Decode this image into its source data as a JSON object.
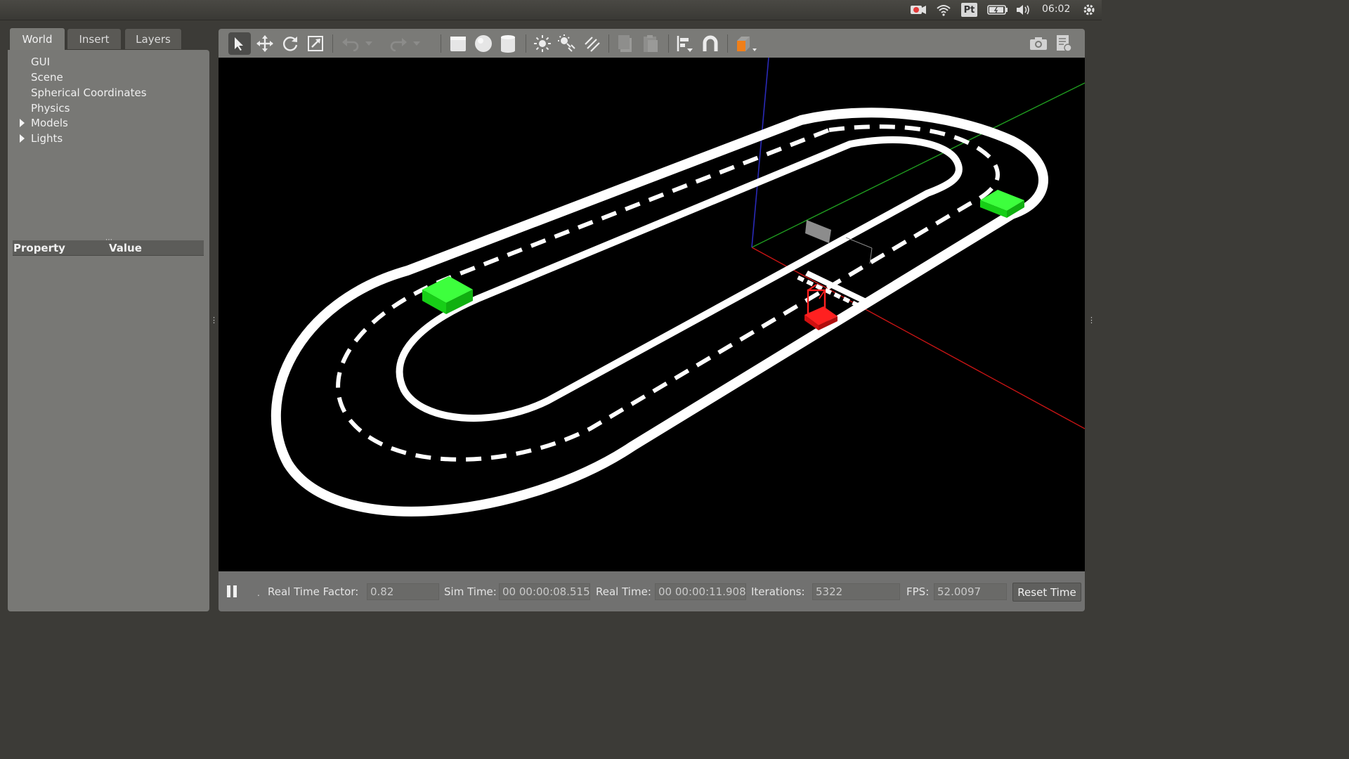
{
  "topbar": {
    "clock": "06:02",
    "icons": [
      "record-icon",
      "wifi-icon",
      "pt-input-icon",
      "battery-icon",
      "volume-icon",
      "settings-gear-icon"
    ],
    "pt_label": "Pt"
  },
  "left_panel": {
    "tabs": [
      {
        "label": "World",
        "active": true
      },
      {
        "label": "Insert",
        "active": false
      },
      {
        "label": "Layers",
        "active": false
      }
    ],
    "tree": [
      {
        "label": "GUI",
        "expandable": false
      },
      {
        "label": "Scene",
        "expandable": false
      },
      {
        "label": "Spherical Coordinates",
        "expandable": false
      },
      {
        "label": "Physics",
        "expandable": false
      },
      {
        "label": "Models",
        "expandable": true
      },
      {
        "label": "Lights",
        "expandable": true
      }
    ],
    "properties": {
      "col_property": "Property",
      "col_value": "Value"
    }
  },
  "toolbar": {
    "tools": [
      "select-arrow-icon",
      "translate-icon",
      "rotate-icon",
      "scale-icon",
      "undo-icon",
      "redo-icon",
      "box-shape-icon",
      "sphere-shape-icon",
      "cylinder-shape-icon",
      "point-light-icon",
      "spot-light-icon",
      "directional-light-icon",
      "copy-icon",
      "paste-icon",
      "align-icon",
      "snap-magnet-icon",
      "view-angle-icon",
      "screenshot-camera-icon",
      "log-icon"
    ],
    "active_tool": "select-arrow-icon"
  },
  "viewport": {
    "scene": "oval race track with dashed center line, two green boxes, red robot car at start line, checkered start line",
    "colors": {
      "background": "#000000",
      "track_line": "#ffffff",
      "obstacle": "#19e619",
      "robot": "#ff1a1a",
      "axis_x": "#c81414",
      "axis_y": "#1e9b1e",
      "axis_z": "#2828b4"
    }
  },
  "bottombar": {
    "real_time_factor_label": "Real Time Factor:",
    "real_time_factor": "0.82",
    "sim_time_label": "Sim Time:",
    "sim_time": "00 00:00:08.515",
    "real_time_label": "Real Time:",
    "real_time": "00 00:00:11.908",
    "iterations_label": "Iterations:",
    "iterations": "5322",
    "fps_label": "FPS:",
    "fps": "52.0097",
    "reset_label": "Reset Time"
  }
}
